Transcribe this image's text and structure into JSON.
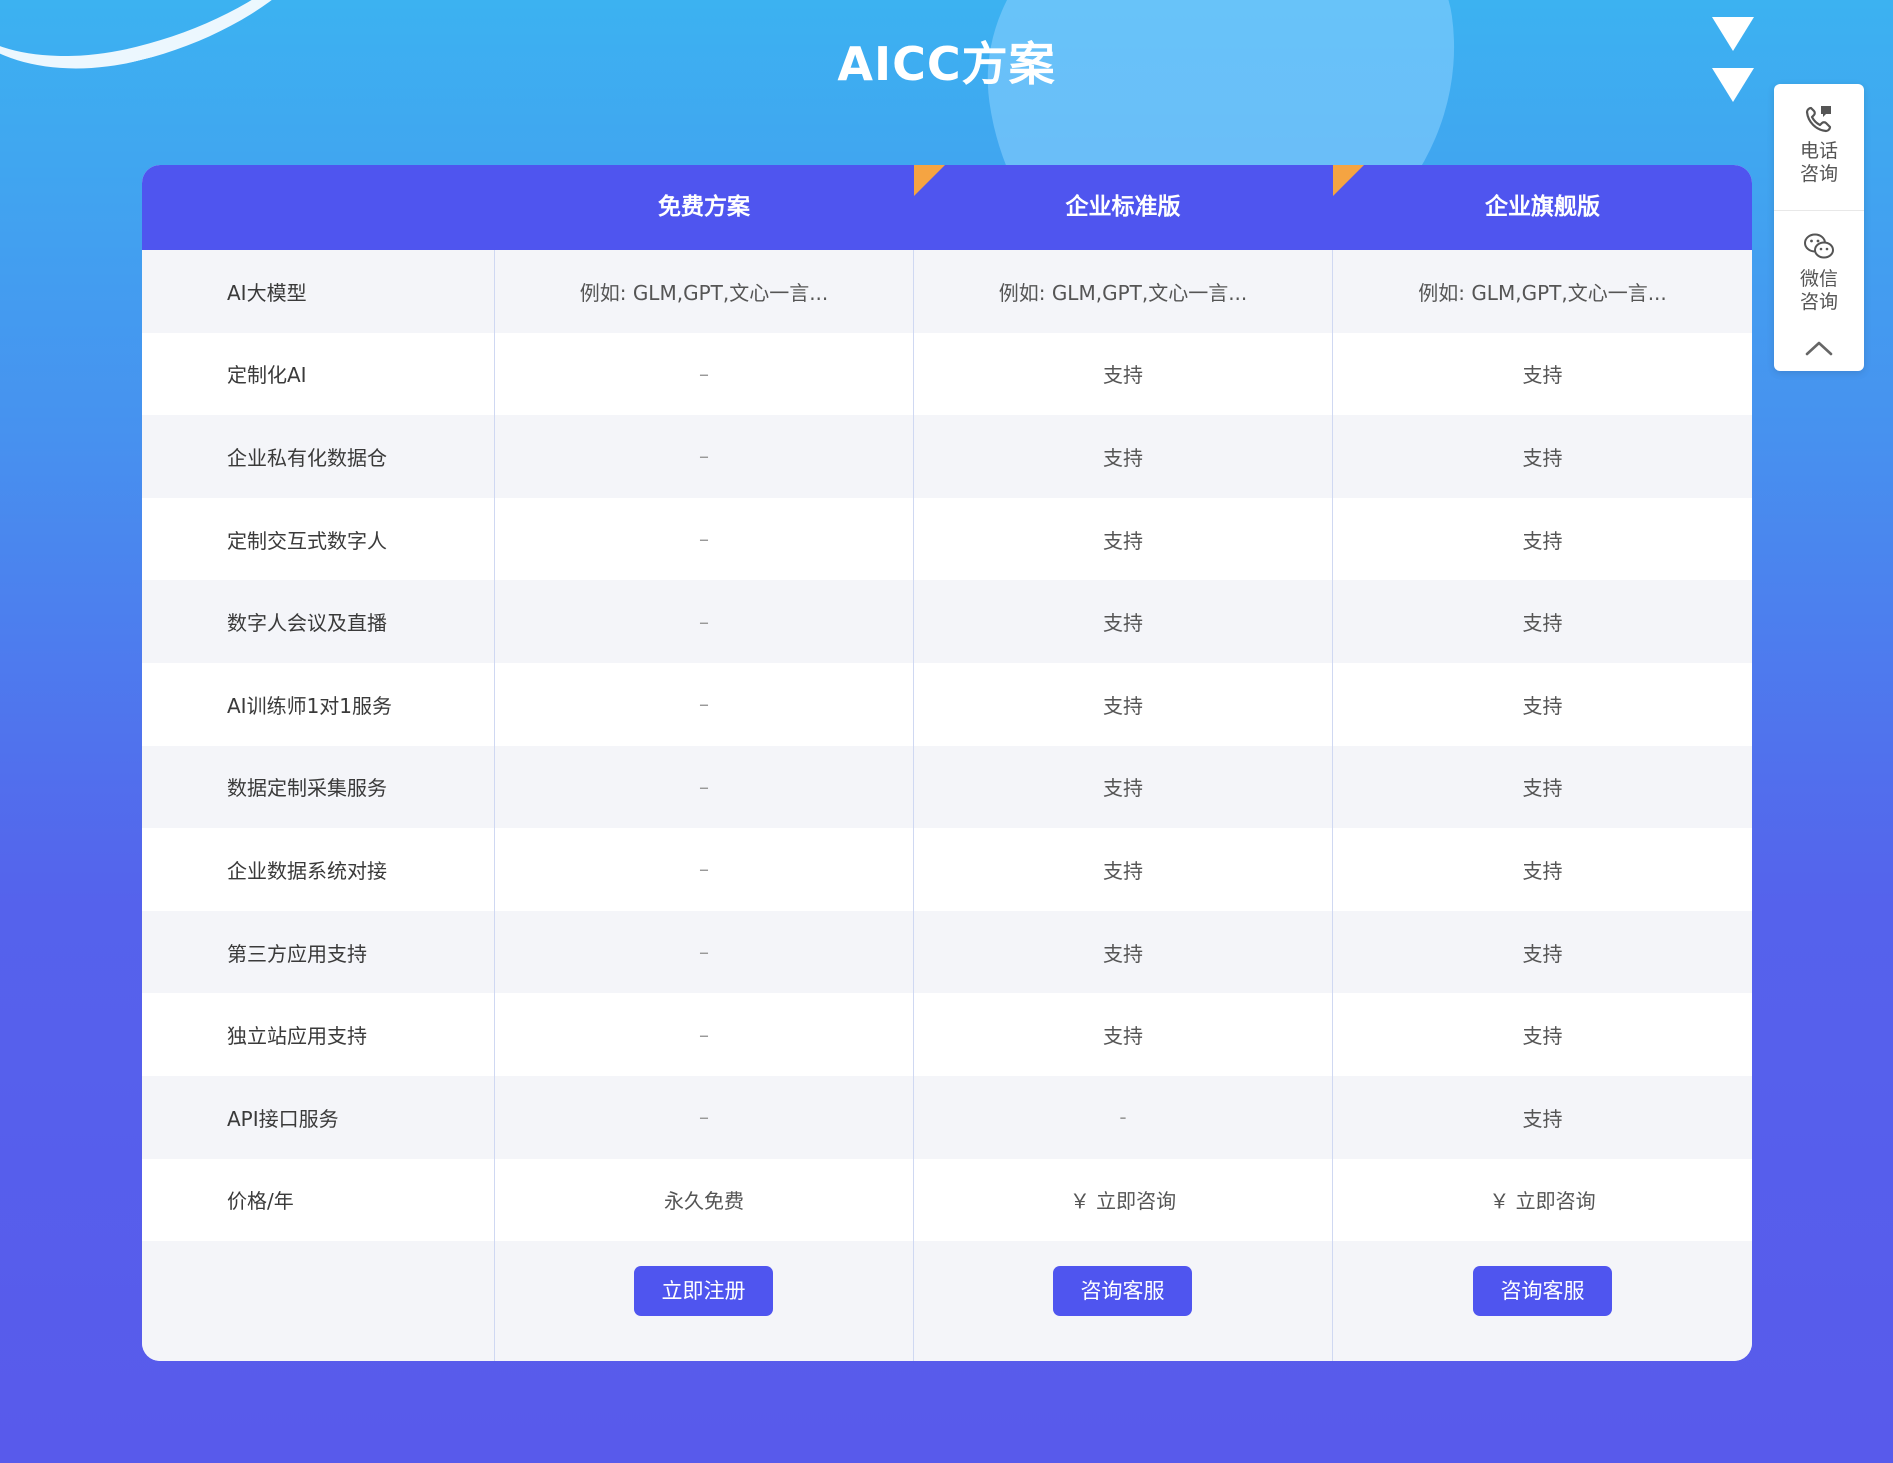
{
  "page_title": "AICC方案",
  "plans": [
    "免费方案",
    "企业标准版",
    "企业旗舰版"
  ],
  "rows": [
    {
      "label": "AI大模型",
      "values": [
        "例如: GLM,GPT,文心一言...",
        "例如: GLM,GPT,文心一言...",
        "例如: GLM,GPT,文心一言..."
      ]
    },
    {
      "label": "定制化AI",
      "values": [
        "–",
        "支持",
        "支持"
      ]
    },
    {
      "label": "企业私有化数据仓",
      "values": [
        "–",
        "支持",
        "支持"
      ]
    },
    {
      "label": "定制交互式数字人",
      "values": [
        "–",
        "支持",
        "支持"
      ]
    },
    {
      "label": "数字人会议及直播",
      "values": [
        "–",
        "支持",
        "支持"
      ]
    },
    {
      "label": "AI训练师1对1服务",
      "values": [
        "–",
        "支持",
        "支持"
      ]
    },
    {
      "label": "数据定制采集服务",
      "values": [
        "–",
        "支持",
        "支持"
      ]
    },
    {
      "label": "企业数据系统对接",
      "values": [
        "–",
        "支持",
        "支持"
      ]
    },
    {
      "label": "第三方应用支持",
      "values": [
        "–",
        "支持",
        "支持"
      ]
    },
    {
      "label": "独立站应用支持",
      "values": [
        "–",
        "支持",
        "支持"
      ]
    },
    {
      "label": "API接口服务",
      "values": [
        "–",
        "-",
        "支持"
      ]
    },
    {
      "label": "价格/年",
      "values": [
        "永久免费",
        "￥ 立即咨询",
        "￥ 立即咨询"
      ]
    }
  ],
  "buttons": [
    "立即注册",
    "咨询客服",
    "咨询客服"
  ],
  "side": {
    "phone_line1": "电话",
    "phone_line2": "咨询",
    "wechat_line1": "微信",
    "wechat_line2": "咨询"
  },
  "colors": {
    "header": "#4f55ef",
    "corner_badge": "#f5a442",
    "button": "#4f55ef"
  },
  "icons": {
    "phone": "phone-icon",
    "wechat": "wechat-icon",
    "scroll_top": "chevron-up-icon",
    "scroll_down": "triangle-down-icon"
  }
}
